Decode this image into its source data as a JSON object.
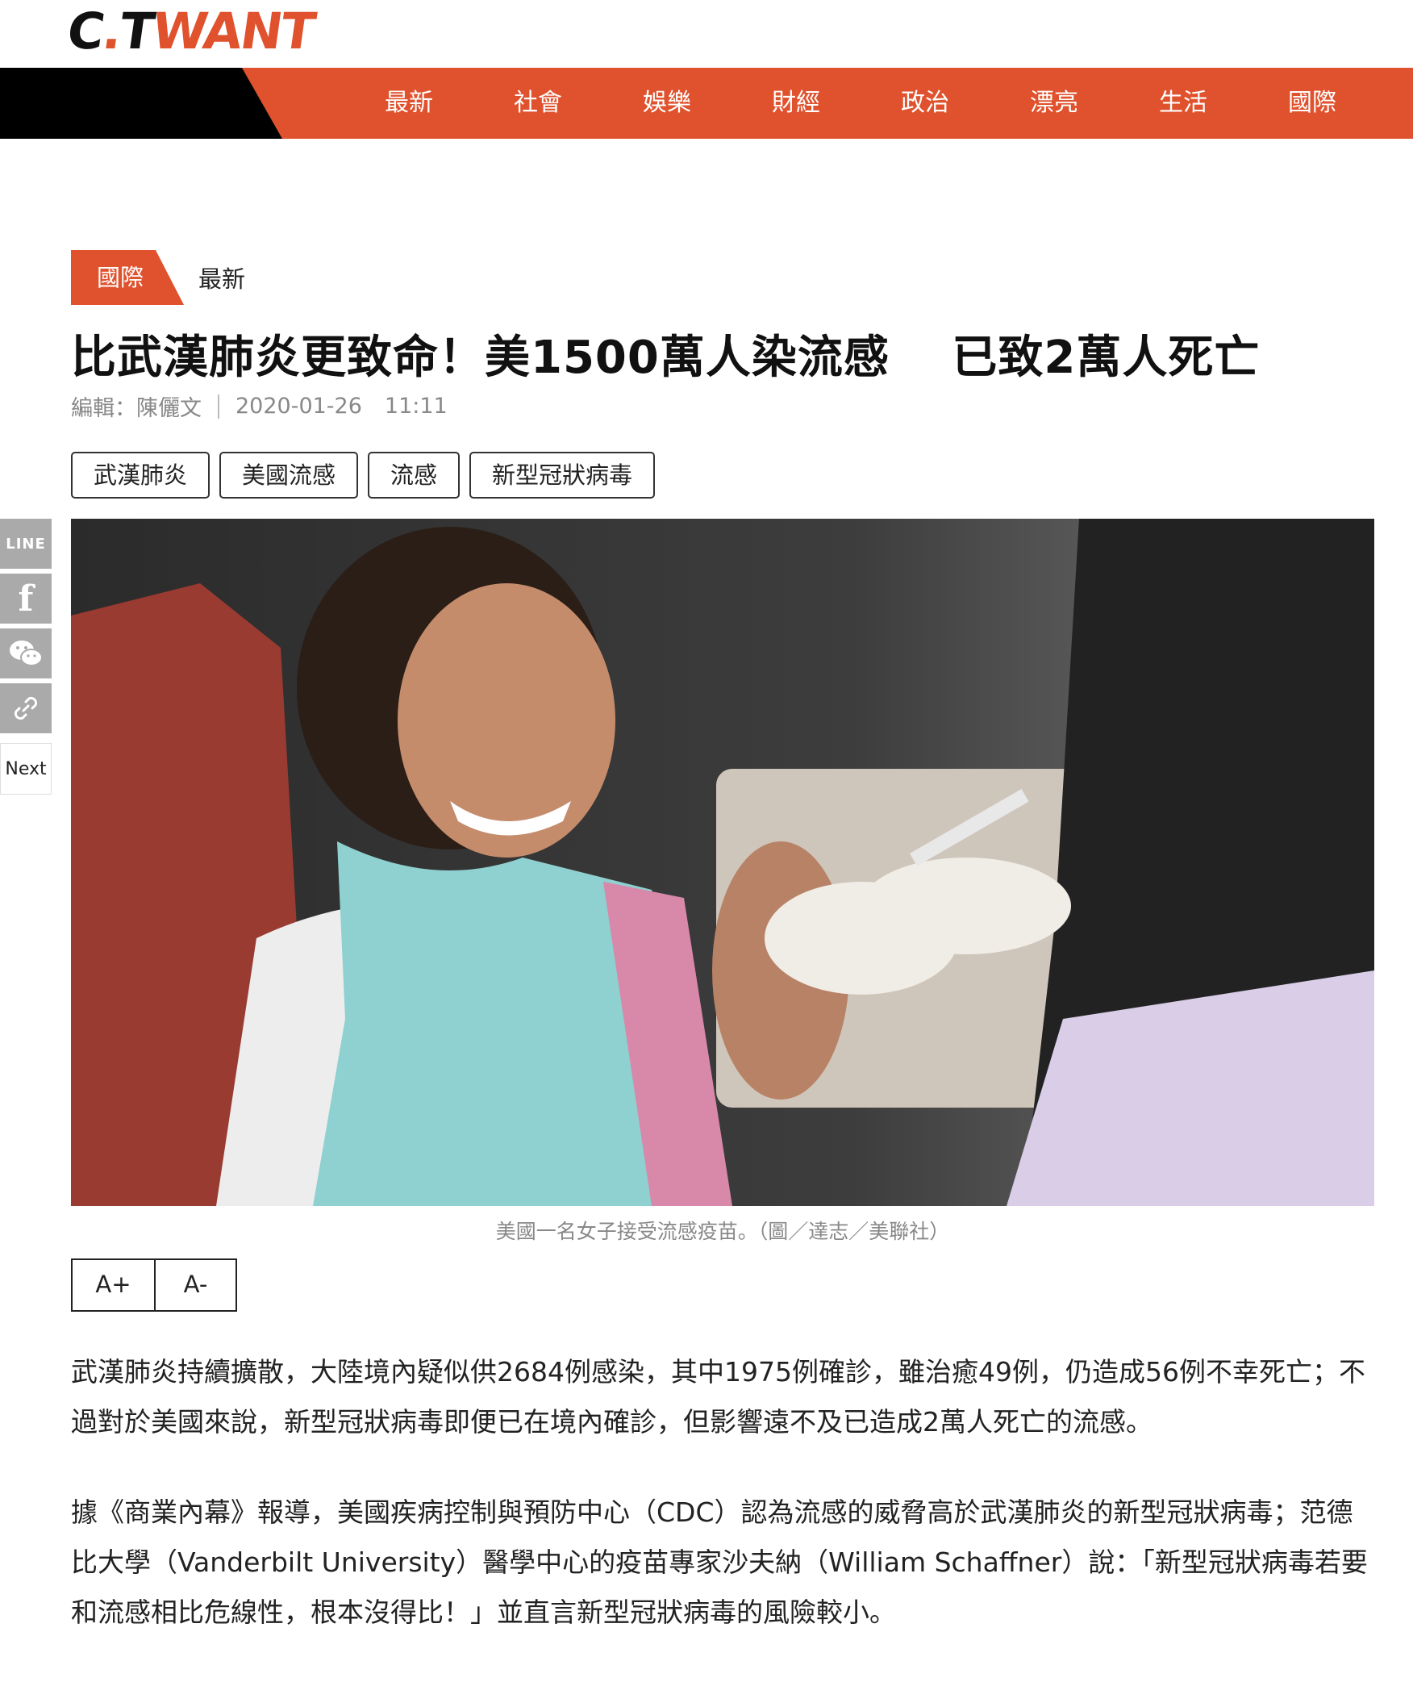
{
  "header": {
    "logo_main": "C",
    "logo_dot": ".",
    "logo_t": "T",
    "logo_want": "WANT"
  },
  "nav": {
    "items": [
      {
        "label": "最新"
      },
      {
        "label": "社會"
      },
      {
        "label": "娛樂"
      },
      {
        "label": "財經"
      },
      {
        "label": "政治"
      },
      {
        "label": "漂亮"
      },
      {
        "label": "生活"
      },
      {
        "label": "國際"
      }
    ]
  },
  "breadcrumb": {
    "category": "國際",
    "subcategory": "最新"
  },
  "article": {
    "title": "比武漢肺炎更致命！美1500萬人染流感　 已致2萬人死亡",
    "editor": "編輯：陳儷文",
    "date": "2020-01-26",
    "time": "11:11",
    "tags": [
      "武漢肺炎",
      "美國流感",
      "流感",
      "新型冠狀病毒"
    ],
    "image_caption": "美國一名女子接受流感疫苗。（圖／達志／美聯社）",
    "paragraphs": [
      "武漢肺炎持續擴散，大陸境內疑似供2684例感染，其中1975例確診，雖治癒49例，仍造成56例不幸死亡；不過對於美國來說，新型冠狀病毒即便已在境內確診，但影響遠不及已造成2萬人死亡的流感。",
      "據《商業內幕》報導，美國疾病控制與預防中心（CDC）認為流感的威脅高於武漢肺炎的新型冠狀病毒；范德比大學（Vanderbilt University）醫學中心的疫苗專家沙夫納（William Schaffner）說：「新型冠狀病毒若要和流感相比危線性，根本沒得比！」並直言新型冠狀病毒的風險較小。"
    ]
  },
  "font_controls": {
    "increase": "A+",
    "decrease": "A-"
  },
  "share": {
    "line_label": "LINE",
    "facebook_label": "f",
    "next_label": "Next"
  },
  "colors": {
    "brand": "#e0522d",
    "nav_black": "#000000",
    "share_gray": "#aaaaaa"
  }
}
